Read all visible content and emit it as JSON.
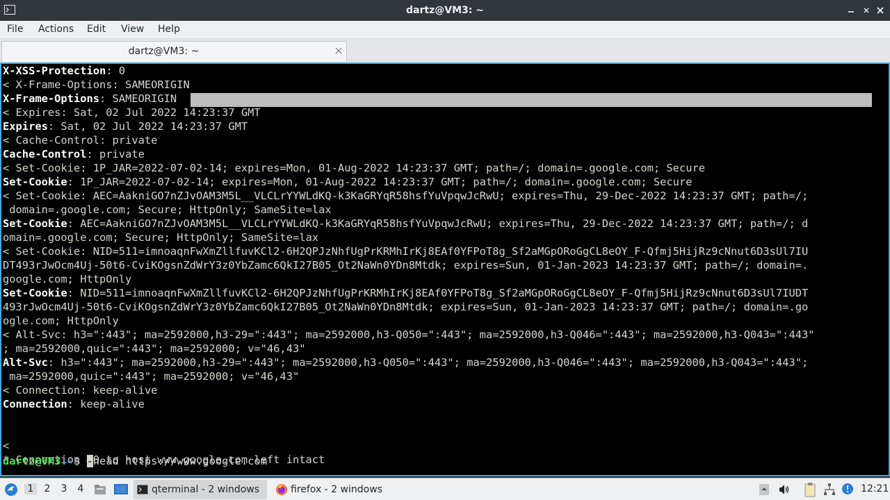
{
  "window": {
    "title": "dartz@VM3: ~",
    "icons": {
      "app": "terminal-icon",
      "minimize": "minimize-icon",
      "maximize": "maximize-icon",
      "close": "close-icon"
    }
  },
  "menu": [
    "File",
    "Actions",
    "Edit",
    "View",
    "Help"
  ],
  "tab": {
    "label": "dartz@VM3: ~",
    "close_icon": "close-tab-icon"
  },
  "terminal": {
    "selection_color": "#bdbdbd",
    "prompt_color": "#4ee64e",
    "lines": [
      {
        "bold": "X-XSS-Protection",
        "rest": ": 0"
      },
      {
        "text": "< X-Frame-Options: SAMEORIGIN"
      },
      {
        "bold": "X-Frame-Options",
        "rest": ": SAMEORIGIN"
      },
      {
        "text": "< Expires: Sat, 02 Jul 2022 14:23:37 GMT"
      },
      {
        "bold": "Expires",
        "rest": ": Sat, 02 Jul 2022 14:23:37 GMT"
      },
      {
        "text": "< Cache-Control: private"
      },
      {
        "bold": "Cache-Control",
        "rest": ": private"
      },
      {
        "text": "< Set-Cookie: 1P_JAR=2022-07-02-14; expires=Mon, 01-Aug-2022 14:23:37 GMT; path=/; domain=.google.com; Secure"
      },
      {
        "bold": "Set-Cookie",
        "rest": ": 1P_JAR=2022-07-02-14; expires=Mon, 01-Aug-2022 14:23:37 GMT; path=/; domain=.google.com; Secure"
      },
      {
        "text": "< Set-Cookie: AEC=AakniGO7nZJvOAM3M5L__VLCLrYYWLdKQ-k3KaGRYqR58hsfYuVpqwJcRwU; expires=Thu, 29-Dec-2022 14:23:37 GMT; path=/;"
      },
      {
        "text": " domain=.google.com; Secure; HttpOnly; SameSite=lax"
      },
      {
        "bold": "Set-Cookie",
        "rest": ": AEC=AakniGO7nZJvOAM3M5L__VLCLrYYWLdKQ-k3KaGRYqR58hsfYuVpqwJcRwU; expires=Thu, 29-Dec-2022 14:23:37 GMT; path=/; d"
      },
      {
        "text": "omain=.google.com; Secure; HttpOnly; SameSite=lax"
      },
      {
        "text": "< Set-Cookie: NID=511=imnoaqnFwXmZllfuvKCl2-6H2QPJzNhfUgPrKRMhIrKj8EAf0YFPoT8g_Sf2aMGpORoGgCL8eOY_F-Qfmj5HijRz9cNnut6D3sUl7IU"
      },
      {
        "text": "DT493rJwOcm4Uj-50t6-CviKOgsnZdWrY3z0YbZamc6QkI27B05_Ot2NaWn0YDn8Mtdk; expires=Sun, 01-Jan-2023 14:23:37 GMT; path=/; domain=."
      },
      {
        "text": "google.com; HttpOnly"
      },
      {
        "bold": "Set-Cookie",
        "rest": ": NID=511=imnoaqnFwXmZllfuvKCl2-6H2QPJzNhfUgPrKRMhIrKj8EAf0YFPoT8g_Sf2aMGpORoGgCL8eOY_F-Qfmj5HijRz9cNnut6D3sUl7IUDT"
      },
      {
        "text": "493rJwOcm4Uj-50t6-CviKOgsnZdWrY3z0YbZamc6QkI27B05_Ot2NaWn0YDn8Mtdk; expires=Sun, 01-Jan-2023 14:23:37 GMT; path=/; domain=.go"
      },
      {
        "text": "ogle.com; HttpOnly"
      },
      {
        "text": "< Alt-Svc: h3=\":443\"; ma=2592000,h3-29=\":443\"; ma=2592000,h3-Q050=\":443\"; ma=2592000,h3-Q046=\":443\"; ma=2592000,h3-Q043=\":443\""
      },
      {
        "text": "; ma=2592000,quic=\":443\"; ma=2592000; v=\"46,43\""
      },
      {
        "bold": "Alt-Svc",
        "rest": ": h3=\":443\"; ma=2592000,h3-29=\":443\"; ma=2592000,h3-Q050=\":443\"; ma=2592000,h3-Q046=\":443\"; ma=2592000,h3-Q043=\":443\";"
      },
      {
        "text": " ma=2592000,quic=\":443\"; ma=2592000; v=\"46,43\""
      },
      {
        "text": "< Connection: keep-alive"
      },
      {
        "bold": "Connection",
        "rest": ": keep-alive"
      },
      {
        "text": ""
      },
      {
        "text": ""
      },
      {
        "text": "<"
      },
      {
        "text": "* Connection #0 to host www.google.com left intact"
      }
    ],
    "prompt": {
      "user_host": "dartz@VM3",
      "path": ":~",
      "symbol": "$ ",
      "cursor_char": "-",
      "command": "head https://www.google.com"
    }
  },
  "taskbar": {
    "start_icon": "start-menu-icon",
    "workspaces": [
      "1",
      "2",
      "3",
      "4"
    ],
    "active_workspace": "1",
    "quick_icons": [
      "file-manager-icon",
      "show-desktop-icon"
    ],
    "tasks": [
      {
        "label": "qterminal - 2 windows",
        "icon": "terminal-icon"
      },
      {
        "label": "firefox - 2 windows",
        "icon": "firefox-icon"
      }
    ],
    "tray_icons": [
      "tray-expand-icon",
      "volume-icon",
      "clipboard-icon",
      "network-icon",
      "update-notifier-icon"
    ],
    "clock": "12:21"
  }
}
